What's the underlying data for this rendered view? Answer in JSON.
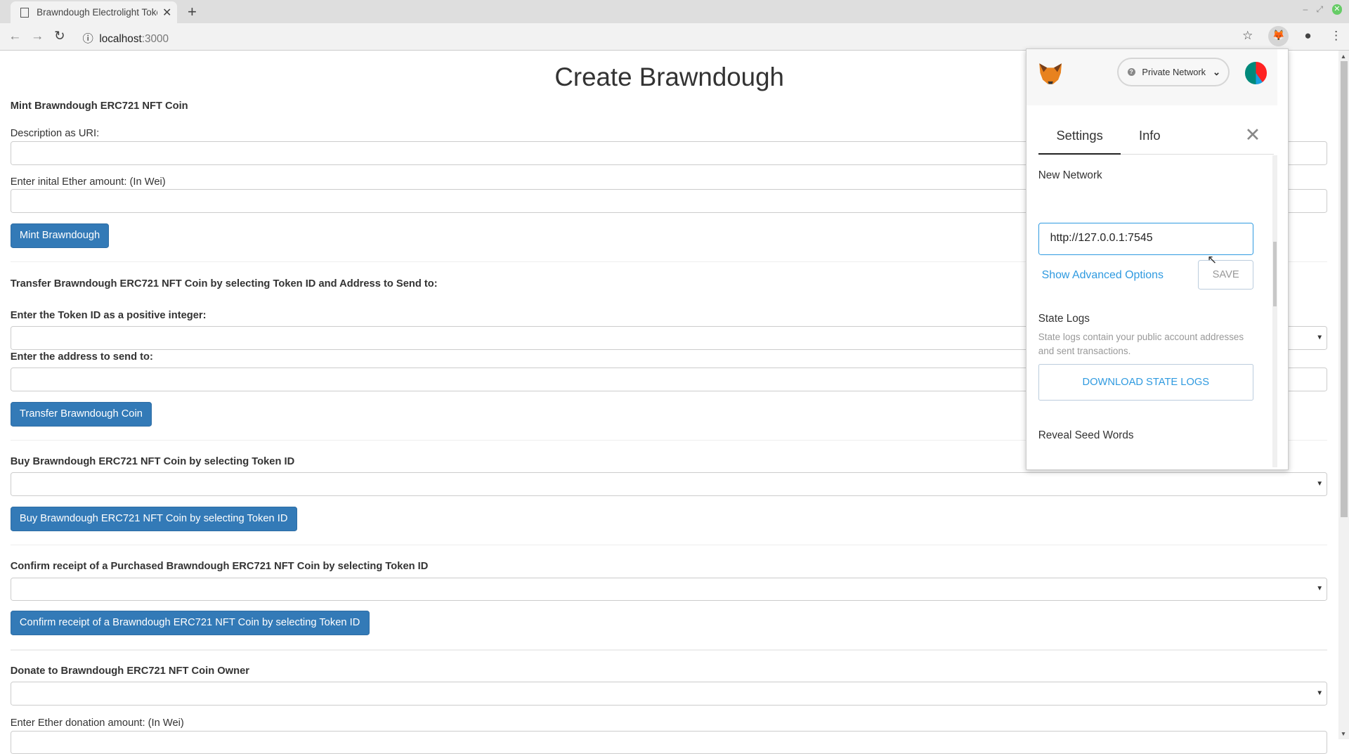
{
  "browser": {
    "tab_title": "Brawndough Electrolight Token",
    "url_host": "localhost",
    "url_port": ":3000"
  },
  "page": {
    "title": "Create Brawndough",
    "mint": {
      "heading": "Mint Brawndough ERC721 NFT Coin",
      "uri_label": "Description as URI:",
      "ether_label": "Enter inital Ether amount: (In Wei)",
      "button": "Mint Brawndough"
    },
    "transfer": {
      "heading": "Transfer Brawndough ERC721 NFT Coin by selecting Token ID and Address to Send to:",
      "token_label": "Enter the Token ID as a positive integer:",
      "address_label": "Enter the address to send to:",
      "button": "Transfer Brawndough Coin"
    },
    "buy": {
      "heading": "Buy Brawndough ERC721 NFT Coin by selecting Token ID",
      "button": "Buy Brawndough ERC721 NFT Coin by selecting Token ID"
    },
    "confirm": {
      "heading": "Confirm receipt of a Purchased Brawndough ERC721 NFT Coin by selecting Token ID",
      "button": "Confirm receipt of a Brawndough ERC721 NFT Coin by selecting Token ID"
    },
    "donate": {
      "heading": "Donate to Brawndough ERC721 NFT Coin Owner",
      "ether_label": "Enter Ether donation amount: (In Wei)"
    }
  },
  "metamask": {
    "network": "Private Network",
    "tabs": [
      "Settings",
      "Info"
    ],
    "active_tab": "Settings",
    "new_network_label": "New Network",
    "rpc_value": "http://127.0.0.1:7545",
    "advanced_link": "Show Advanced Options",
    "save": "SAVE",
    "state_logs_title": "State Logs",
    "state_logs_desc": "State logs contain your public account addresses and sent transactions.",
    "download_button": "DOWNLOAD STATE LOGS",
    "reveal_title": "Reveal Seed Words",
    "accent": "#2f9ae0"
  }
}
